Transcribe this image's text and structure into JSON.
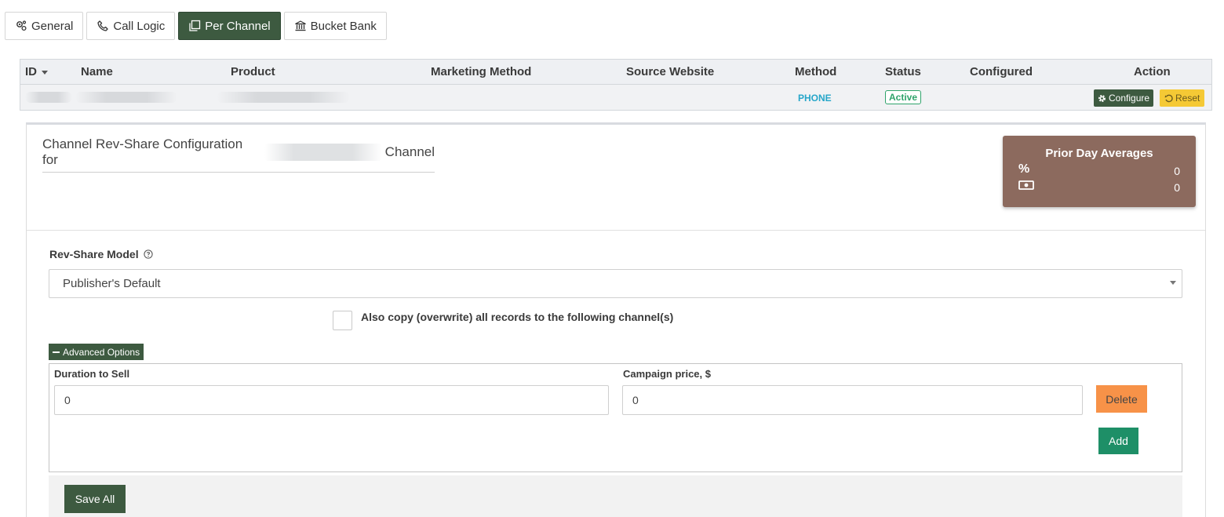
{
  "tabs": [
    {
      "label": "General",
      "icon": "gears-icon",
      "active": false
    },
    {
      "label": "Call Logic",
      "icon": "phone-icon",
      "active": false
    },
    {
      "label": "Per Channel",
      "icon": "copy-icon",
      "active": true
    },
    {
      "label": "Bucket Bank",
      "icon": "bank-icon",
      "active": false
    }
  ],
  "table": {
    "headers": {
      "id": "ID",
      "name": "Name",
      "product": "Product",
      "marketing_method": "Marketing Method",
      "source_website": "Source Website",
      "method": "Method",
      "status": "Status",
      "configured": "Configured",
      "action": "Action"
    },
    "row": {
      "method": "PHONE",
      "status": "Active",
      "configure_label": "Configure",
      "reset_label": "Reset"
    }
  },
  "panel": {
    "title_prefix": "Channel Rev-Share Configuration for",
    "title_suffix": "Channel",
    "averages": {
      "title": "Prior Day Averages",
      "percent_symbol": "%",
      "percent_value": "0",
      "money_value": "0"
    },
    "model_label": "Rev-Share Model",
    "model_value": "Publisher's Default",
    "copy_label": "Also copy (overwrite) all records to the following channel(s)",
    "advanced_label": "Advanced Options",
    "duration_label": "Duration to Sell",
    "duration_value": "0",
    "price_label": "Campaign price, $",
    "price_value": "0",
    "delete_label": "Delete",
    "add_label": "Add",
    "save_label": "Save All"
  },
  "colors": {
    "primary": "#3d5a40",
    "accent_phone": "#26a6c9",
    "status_active": "#2fa36b",
    "averages_bg": "#8c6a5e",
    "reset": "#f5c935",
    "delete": "#f79248",
    "add": "#1e8f67"
  }
}
